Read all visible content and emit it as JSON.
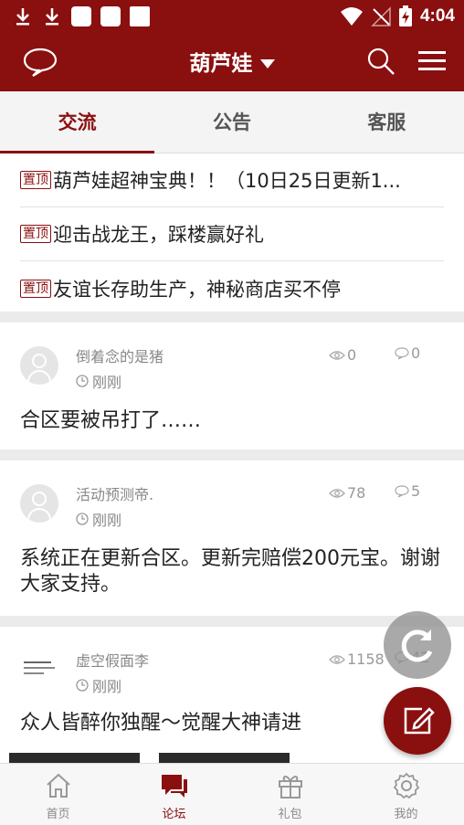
{
  "status_bar": {
    "time": "4:04",
    "icons": [
      "download-icon",
      "download-icon",
      "app-icon",
      "app-icon",
      "app-icon",
      "wifi-icon",
      "no-signal-icon",
      "battery-charging-icon"
    ]
  },
  "app_bar": {
    "title": "葫芦娃",
    "icons": [
      "chat-bubble-icon",
      "caret-down-icon",
      "search-icon",
      "menu-icon"
    ]
  },
  "tabs": [
    {
      "label": "交流",
      "active": true
    },
    {
      "label": "公告",
      "active": false
    },
    {
      "label": "客服",
      "active": false
    }
  ],
  "pinned": [
    {
      "tag": "置顶",
      "text": "葫芦娃超神宝典！！（10日25日更新1..."
    },
    {
      "tag": "置顶",
      "text": "迎击战龙王，踩楼赢好礼"
    },
    {
      "tag": "置顶",
      "text": "友谊长存助生产，神秘商店买不停"
    }
  ],
  "posts": [
    {
      "author": "倒着念的是猪",
      "time": "刚刚",
      "views": "0",
      "replies": "0",
      "body": "合区要被吊打了……"
    },
    {
      "author": "活动预测帝.",
      "time": "刚刚",
      "views": "78",
      "replies": "5",
      "body": "系统正在更新合区。更新完赔偿200元宝。谢谢大家支持。"
    },
    {
      "author": "虚空假面李",
      "time": "刚刚",
      "views": "1158",
      "replies": "42",
      "body": "众人皆醉你独醒～觉醒大神请进"
    }
  ],
  "bottom_nav": [
    {
      "label": "首页",
      "icon": "home-icon",
      "active": false
    },
    {
      "label": "论坛",
      "icon": "forum-icon",
      "active": true
    },
    {
      "label": "礼包",
      "icon": "gift-icon",
      "active": false
    },
    {
      "label": "我的",
      "icon": "settings-icon",
      "active": false
    }
  ],
  "colors": {
    "brand": "#8a0f0f",
    "background": "#ffffff",
    "separator": "#ebebeb"
  }
}
